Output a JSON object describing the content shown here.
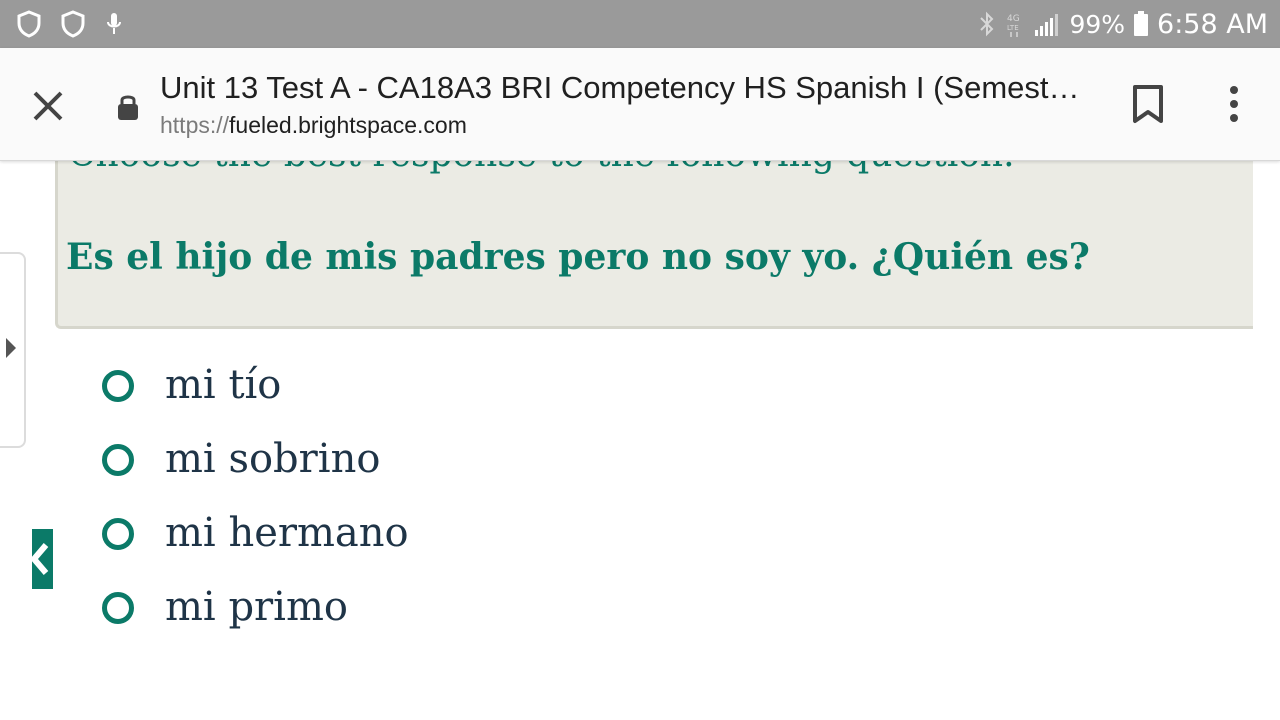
{
  "status_bar": {
    "battery_percent": "99%",
    "time": "6:58 AM",
    "network_label": "4G LTE"
  },
  "toolbar": {
    "title": "Unit 13 Test A - CA18A3 BRI Competency HS Spanish I (Semest…",
    "url_scheme": "https://",
    "url_domain": "fueled.brightspace.com"
  },
  "question": {
    "instruction": "Choose the best response to the following question.",
    "text": "Es el hijo de mis padres pero no soy yo. ¿Quién es?"
  },
  "answers": [
    {
      "label": "mi tío"
    },
    {
      "label": "mi sobrino"
    },
    {
      "label": "mi hermano"
    },
    {
      "label": "mi primo"
    }
  ],
  "colors": {
    "accent": "#0b7a68",
    "answer_text": "#1f3447",
    "question_bg": "#ebebe4",
    "status_bar": "#9a9a9a"
  }
}
